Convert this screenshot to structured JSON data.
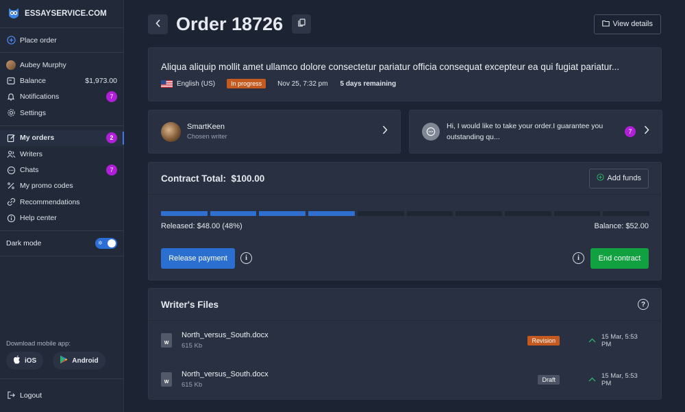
{
  "brand": {
    "prefix": "ESSAY",
    "suffix": "SERVICE.COM"
  },
  "sidebar": {
    "place_order": "Place order",
    "user_name": "Aubey Murphy",
    "balance_label": "Balance",
    "balance_value": "$1,973.00",
    "notifications_label": "Notifications",
    "notifications_count": "7",
    "settings_label": "Settings",
    "my_orders_label": "My orders",
    "my_orders_count": "2",
    "writers_label": "Writers",
    "chats_label": "Chats",
    "chats_count": "7",
    "promo_label": "My promo codes",
    "recommendations_label": "Recommendations",
    "help_label": "Help center",
    "dark_mode_label": "Dark mode",
    "download_label": "Download mobile app:",
    "ios_label": "iOS",
    "android_label": "Android",
    "logout_label": "Logout"
  },
  "header": {
    "title": "Order 18726",
    "view_details": "View details"
  },
  "order": {
    "description": "Aliqua aliquip mollit amet ullamco dolore consectetur pariatur officia consequat excepteur ea qui fugiat pariatur...",
    "language": "English (US)",
    "status": "In progress",
    "date": "Nov 25, 7:32 pm",
    "remaining": "5 days remaining"
  },
  "writer": {
    "name": "SmartKeen",
    "subtitle": "Chosen writer"
  },
  "chat": {
    "message": "Hi, I would like to take your order.I guarantee you outstanding qu...",
    "count": "7"
  },
  "contract": {
    "title": "Contract Total:",
    "total": "$100.00",
    "add_funds": "Add funds",
    "released": "Released: $48.00 (48%)",
    "balance": "Balance: $52.00",
    "progress_fraction": 0.48,
    "release_button": "Release payment",
    "end_button": "End contract"
  },
  "files": {
    "title": "Writer's Files",
    "items": [
      {
        "name": "North_versus_South.docx",
        "size": "615 Kb",
        "status": "Revision",
        "date": "15 Mar, 5:53 PM"
      },
      {
        "name": "North_versus_South.docx",
        "size": "615 Kb",
        "status": "Draft",
        "date": "15 Mar, 5:53 PM"
      }
    ]
  },
  "colors": {
    "accent": "#2b6fd0",
    "success": "#12a140",
    "badge": "#b11ed8",
    "revision": "#c45a1f"
  }
}
